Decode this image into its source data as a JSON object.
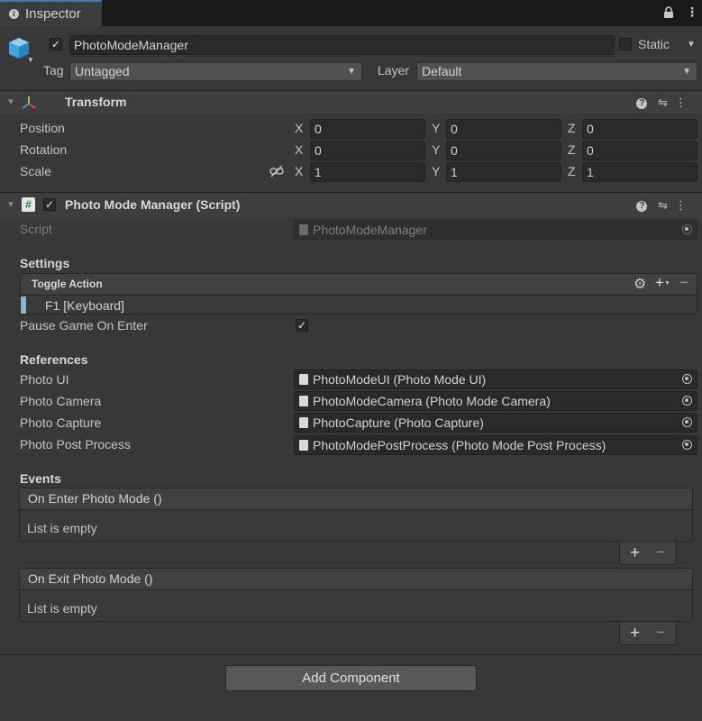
{
  "tab": {
    "title": "Inspector"
  },
  "object": {
    "name": "PhotoModeManager",
    "active": true,
    "static_label": "Static",
    "static": false,
    "tag_label": "Tag",
    "tag": "Untagged",
    "layer_label": "Layer",
    "layer": "Default"
  },
  "transform": {
    "title": "Transform",
    "rows": [
      {
        "label": "Position",
        "x": "0",
        "y": "0",
        "z": "0"
      },
      {
        "label": "Rotation",
        "x": "0",
        "y": "0",
        "z": "0"
      },
      {
        "label": "Scale",
        "x": "1",
        "y": "1",
        "z": "1"
      }
    ]
  },
  "axes": {
    "x": "X",
    "y": "Y",
    "z": "Z"
  },
  "script_component": {
    "title": "Photo Mode Manager (Script)",
    "script_label": "Script",
    "script_value": "PhotoModeManager",
    "settings_header": "Settings",
    "toggle_action_label": "Toggle Action",
    "binding": "F1 [Keyboard]",
    "pause_label": "Pause Game On Enter",
    "pause_checked": true,
    "references_header": "References",
    "references": [
      {
        "label": "Photo UI",
        "value": "PhotoModeUI (Photo Mode UI)"
      },
      {
        "label": "Photo Camera",
        "value": "PhotoModeCamera (Photo Mode Camera)"
      },
      {
        "label": "Photo Capture",
        "value": "PhotoCapture (Photo Capture)"
      },
      {
        "label": "Photo Post Process",
        "value": "PhotoModePostProcess (Photo Mode Post Process)"
      }
    ],
    "events_header": "Events",
    "events": [
      {
        "title": "On Enter Photo Mode ()",
        "empty": "List is empty"
      },
      {
        "title": "On Exit Photo Mode ()",
        "empty": "List is empty"
      }
    ]
  },
  "add_component": "Add Component",
  "colors": {
    "accent_tab": "#3a79bb",
    "binding_bar": "#8fb3c4",
    "background": "#383838"
  }
}
